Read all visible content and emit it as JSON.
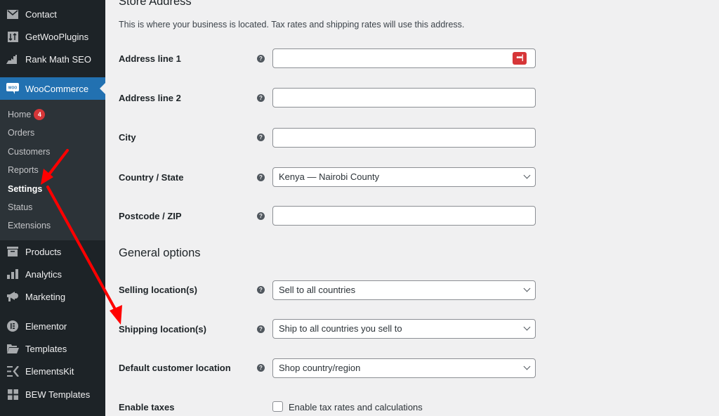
{
  "sidebar": {
    "menu": [
      {
        "label": "Contact",
        "icon": "envelope-icon"
      },
      {
        "label": "GetWooPlugins",
        "icon": "sort-icon"
      },
      {
        "label": "Rank Math SEO",
        "icon": "chart-icon"
      },
      {
        "label": "WooCommerce",
        "icon": "woo-icon",
        "active": true
      },
      {
        "label": "Products",
        "icon": "archive-icon"
      },
      {
        "label": "Analytics",
        "icon": "bar-chart-icon"
      },
      {
        "label": "Marketing",
        "icon": "megaphone-icon"
      },
      {
        "label": "Elementor",
        "icon": "elementor-icon"
      },
      {
        "label": "Templates",
        "icon": "folder-icon"
      },
      {
        "label": "ElementsKit",
        "icon": "elementskit-icon"
      },
      {
        "label": "BEW Templates",
        "icon": "grid-icon"
      }
    ],
    "submenu": [
      {
        "label": "Home",
        "badge": "4"
      },
      {
        "label": "Orders"
      },
      {
        "label": "Customers"
      },
      {
        "label": "Reports"
      },
      {
        "label": "Settings",
        "current": true
      },
      {
        "label": "Status"
      },
      {
        "label": "Extensions"
      }
    ]
  },
  "main": {
    "store_address": {
      "title": "Store Address",
      "description": "This is where your business is located. Tax rates and shipping rates will use this address.",
      "fields": [
        {
          "label": "Address line 1",
          "value": ""
        },
        {
          "label": "Address line 2",
          "value": ""
        },
        {
          "label": "City",
          "value": ""
        },
        {
          "label": "Country / State",
          "value": "Kenya — Nairobi County"
        },
        {
          "label": "Postcode / ZIP",
          "value": ""
        }
      ]
    },
    "general_options": {
      "title": "General options",
      "fields": [
        {
          "label": "Selling location(s)",
          "value": "Sell to all countries"
        },
        {
          "label": "Shipping location(s)",
          "value": "Ship to all countries you sell to"
        },
        {
          "label": "Default customer location",
          "value": "Shop country/region"
        }
      ],
      "enable_taxes": {
        "label": "Enable taxes",
        "checkbox_label": "Enable tax rates and calculations",
        "checked": false
      }
    },
    "help_glyph": "?",
    "password_manager_glyph": "•••|"
  },
  "colors": {
    "accent": "#2271b1",
    "sidebar_bg": "#1d2327",
    "submenu_bg": "#2c3338",
    "badge": "#d63638",
    "annotation_arrow": "#ff0000"
  }
}
